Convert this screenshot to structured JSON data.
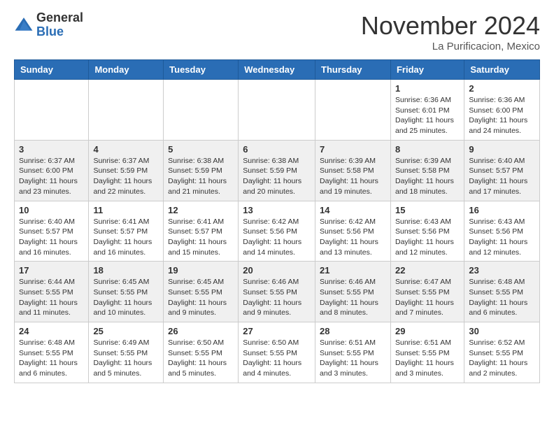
{
  "header": {
    "logo_general": "General",
    "logo_blue": "Blue",
    "month_title": "November 2024",
    "location": "La Purificacion, Mexico"
  },
  "calendar": {
    "days_of_week": [
      "Sunday",
      "Monday",
      "Tuesday",
      "Wednesday",
      "Thursday",
      "Friday",
      "Saturday"
    ],
    "weeks": [
      [
        {
          "day": "",
          "info": ""
        },
        {
          "day": "",
          "info": ""
        },
        {
          "day": "",
          "info": ""
        },
        {
          "day": "",
          "info": ""
        },
        {
          "day": "",
          "info": ""
        },
        {
          "day": "1",
          "info": "Sunrise: 6:36 AM\nSunset: 6:01 PM\nDaylight: 11 hours and 25 minutes."
        },
        {
          "day": "2",
          "info": "Sunrise: 6:36 AM\nSunset: 6:00 PM\nDaylight: 11 hours and 24 minutes."
        }
      ],
      [
        {
          "day": "3",
          "info": "Sunrise: 6:37 AM\nSunset: 6:00 PM\nDaylight: 11 hours and 23 minutes."
        },
        {
          "day": "4",
          "info": "Sunrise: 6:37 AM\nSunset: 5:59 PM\nDaylight: 11 hours and 22 minutes."
        },
        {
          "day": "5",
          "info": "Sunrise: 6:38 AM\nSunset: 5:59 PM\nDaylight: 11 hours and 21 minutes."
        },
        {
          "day": "6",
          "info": "Sunrise: 6:38 AM\nSunset: 5:59 PM\nDaylight: 11 hours and 20 minutes."
        },
        {
          "day": "7",
          "info": "Sunrise: 6:39 AM\nSunset: 5:58 PM\nDaylight: 11 hours and 19 minutes."
        },
        {
          "day": "8",
          "info": "Sunrise: 6:39 AM\nSunset: 5:58 PM\nDaylight: 11 hours and 18 minutes."
        },
        {
          "day": "9",
          "info": "Sunrise: 6:40 AM\nSunset: 5:57 PM\nDaylight: 11 hours and 17 minutes."
        }
      ],
      [
        {
          "day": "10",
          "info": "Sunrise: 6:40 AM\nSunset: 5:57 PM\nDaylight: 11 hours and 16 minutes."
        },
        {
          "day": "11",
          "info": "Sunrise: 6:41 AM\nSunset: 5:57 PM\nDaylight: 11 hours and 16 minutes."
        },
        {
          "day": "12",
          "info": "Sunrise: 6:41 AM\nSunset: 5:57 PM\nDaylight: 11 hours and 15 minutes."
        },
        {
          "day": "13",
          "info": "Sunrise: 6:42 AM\nSunset: 5:56 PM\nDaylight: 11 hours and 14 minutes."
        },
        {
          "day": "14",
          "info": "Sunrise: 6:42 AM\nSunset: 5:56 PM\nDaylight: 11 hours and 13 minutes."
        },
        {
          "day": "15",
          "info": "Sunrise: 6:43 AM\nSunset: 5:56 PM\nDaylight: 11 hours and 12 minutes."
        },
        {
          "day": "16",
          "info": "Sunrise: 6:43 AM\nSunset: 5:56 PM\nDaylight: 11 hours and 12 minutes."
        }
      ],
      [
        {
          "day": "17",
          "info": "Sunrise: 6:44 AM\nSunset: 5:55 PM\nDaylight: 11 hours and 11 minutes."
        },
        {
          "day": "18",
          "info": "Sunrise: 6:45 AM\nSunset: 5:55 PM\nDaylight: 11 hours and 10 minutes."
        },
        {
          "day": "19",
          "info": "Sunrise: 6:45 AM\nSunset: 5:55 PM\nDaylight: 11 hours and 9 minutes."
        },
        {
          "day": "20",
          "info": "Sunrise: 6:46 AM\nSunset: 5:55 PM\nDaylight: 11 hours and 9 minutes."
        },
        {
          "day": "21",
          "info": "Sunrise: 6:46 AM\nSunset: 5:55 PM\nDaylight: 11 hours and 8 minutes."
        },
        {
          "day": "22",
          "info": "Sunrise: 6:47 AM\nSunset: 5:55 PM\nDaylight: 11 hours and 7 minutes."
        },
        {
          "day": "23",
          "info": "Sunrise: 6:48 AM\nSunset: 5:55 PM\nDaylight: 11 hours and 6 minutes."
        }
      ],
      [
        {
          "day": "24",
          "info": "Sunrise: 6:48 AM\nSunset: 5:55 PM\nDaylight: 11 hours and 6 minutes."
        },
        {
          "day": "25",
          "info": "Sunrise: 6:49 AM\nSunset: 5:55 PM\nDaylight: 11 hours and 5 minutes."
        },
        {
          "day": "26",
          "info": "Sunrise: 6:50 AM\nSunset: 5:55 PM\nDaylight: 11 hours and 5 minutes."
        },
        {
          "day": "27",
          "info": "Sunrise: 6:50 AM\nSunset: 5:55 PM\nDaylight: 11 hours and 4 minutes."
        },
        {
          "day": "28",
          "info": "Sunrise: 6:51 AM\nSunset: 5:55 PM\nDaylight: 11 hours and 3 minutes."
        },
        {
          "day": "29",
          "info": "Sunrise: 6:51 AM\nSunset: 5:55 PM\nDaylight: 11 hours and 3 minutes."
        },
        {
          "day": "30",
          "info": "Sunrise: 6:52 AM\nSunset: 5:55 PM\nDaylight: 11 hours and 2 minutes."
        }
      ]
    ]
  }
}
